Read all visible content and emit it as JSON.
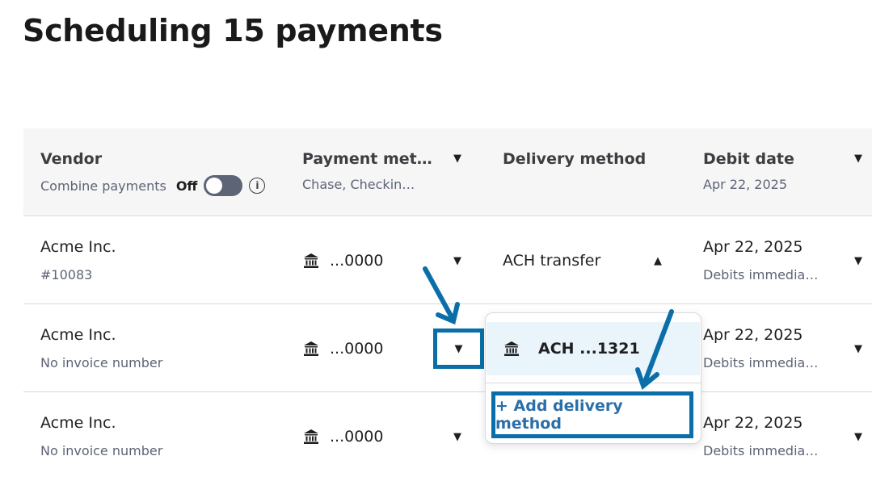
{
  "page": {
    "title": "Scheduling 15 payments"
  },
  "header": {
    "vendor": {
      "label": "Vendor",
      "combine_label": "Combine payments",
      "toggle_state": "Off"
    },
    "payment_method": {
      "label": "Payment met…",
      "sub": "Chase, Checkin…"
    },
    "delivery_method": {
      "label": "Delivery method"
    },
    "debit_date": {
      "label": "Debit date",
      "sub": "Apr 22, 2025"
    }
  },
  "rows": [
    {
      "vendor": "Acme Inc.",
      "sub": "#10083",
      "account": "...0000",
      "delivery": "ACH transfer",
      "date": "Apr 22, 2025",
      "date_sub": "Debits immedia…"
    },
    {
      "vendor": "Acme Inc.",
      "sub": "No invoice number",
      "account": "...0000",
      "delivery": "",
      "date": "Apr 22, 2025",
      "date_sub": "Debits immedia…"
    },
    {
      "vendor": "Acme Inc.",
      "sub": "No invoice number",
      "account": "...0000",
      "delivery": "",
      "date": "Apr 22, 2025",
      "date_sub": "Debits immedia…"
    }
  ],
  "dropdown": {
    "option_label": "ACH ...1321",
    "add_label": "+ Add delivery method"
  },
  "icons": {
    "bank": "bank-icon",
    "caret_down": "caret-down-icon",
    "caret_up": "caret-up-icon",
    "info": "info-icon"
  },
  "colors": {
    "highlight": "#0a6fa8",
    "link": "#2a6fa8",
    "header_bg": "#f6f6f7",
    "option_bg": "#eaf4fb",
    "toggle_off": "#5d6475"
  }
}
